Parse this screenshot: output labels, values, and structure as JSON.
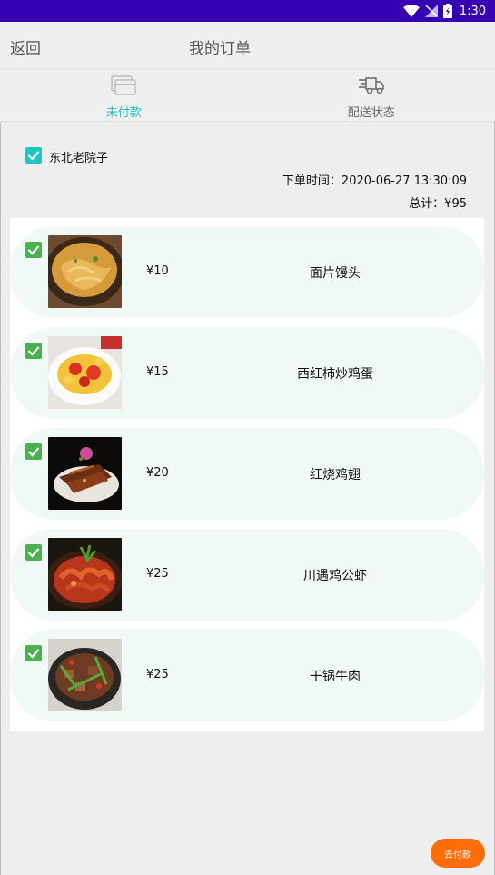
{
  "status_bar": {
    "time": "1:30"
  },
  "app_bar": {
    "back_label": "返回",
    "title": "我的订单"
  },
  "tabs": [
    {
      "label": "未付款",
      "icon": "card-icon",
      "active": true
    },
    {
      "label": "配送状态",
      "icon": "delivery-truck-icon",
      "active": false
    }
  ],
  "order": {
    "store_name": "东北老院子",
    "store_checked": true,
    "order_time": "下单时间：2020-06-27 13:30:09",
    "total": "总计：¥95"
  },
  "items": [
    {
      "price": "¥10",
      "name": "面片馒头",
      "checked": true,
      "image": "noodle-stew-photo"
    },
    {
      "price": "¥15",
      "name": "西红柿炒鸡蛋",
      "checked": true,
      "image": "tomato-egg-photo"
    },
    {
      "price": "¥20",
      "name": "红烧鸡翅",
      "checked": true,
      "image": "braised-chicken-wings-photo"
    },
    {
      "price": "¥25",
      "name": "川遇鸡公虾",
      "checked": true,
      "image": "spicy-shrimp-chicken-photo"
    },
    {
      "price": "¥25",
      "name": "干锅牛肉",
      "checked": true,
      "image": "dry-pot-beef-photo"
    }
  ],
  "pay_button": {
    "label": "去付款"
  },
  "colors": {
    "status_bar": "#3700b3",
    "accent": "#1fc2c2",
    "item_check": "#4caf50",
    "card_bg": "#f1f9f6",
    "pay_button": "#ff6d0a"
  }
}
